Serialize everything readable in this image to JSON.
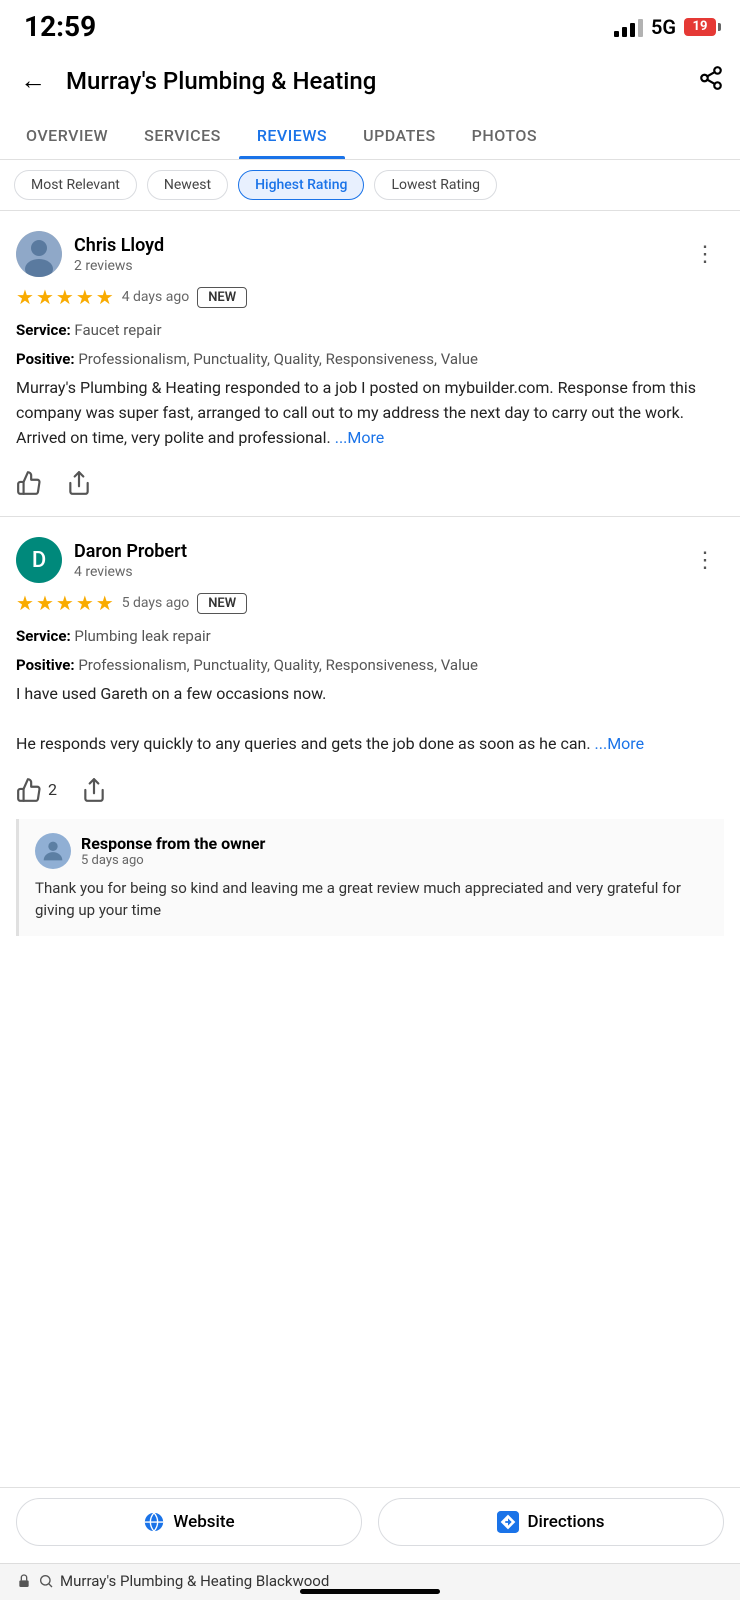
{
  "statusBar": {
    "time": "12:59",
    "network": "5G",
    "battery": "19"
  },
  "header": {
    "title": "Murray's Plumbing & Heating",
    "back_label": "←",
    "share_label": "share"
  },
  "tabs": [
    {
      "id": "overview",
      "label": "OVERVIEW",
      "active": false
    },
    {
      "id": "services",
      "label": "SERVICES",
      "active": false
    },
    {
      "id": "reviews",
      "label": "REVIEWS",
      "active": true
    },
    {
      "id": "updates",
      "label": "UPDATES",
      "active": false
    },
    {
      "id": "photos",
      "label": "PHOTOS",
      "active": false
    }
  ],
  "filters": [
    {
      "id": "most-relevant",
      "label": "Most Relevant",
      "active": false
    },
    {
      "id": "newest",
      "label": "Newest",
      "active": false
    },
    {
      "id": "highest-rating",
      "label": "Highest Rating",
      "active": true
    },
    {
      "id": "lowest-rating",
      "label": "Lowest Rating",
      "active": false
    }
  ],
  "reviews": [
    {
      "id": "review-1",
      "reviewer": {
        "name": "Chris Lloyd",
        "count": "2 reviews",
        "avatar_type": "photo",
        "avatar_letter": "C",
        "avatar_color": "#6d8fb8"
      },
      "stars": 5,
      "time": "4 days ago",
      "is_new": true,
      "new_badge": "NEW",
      "service_label": "Service:",
      "service_value": "Faucet repair",
      "positive_label": "Positive:",
      "positive_value": "Professionalism, Punctuality, Quality, Responsiveness, Value",
      "text": "Murray's Plumbing & Heating responded to a job I posted on mybuilder.com. Response from this company was super fast, arranged to call out to my address the next day to carry out the work. Arrived on time, very polite and professional.",
      "more_label": "...More",
      "likes": 0,
      "owner_response": null
    },
    {
      "id": "review-2",
      "reviewer": {
        "name": "Daron Probert",
        "count": "4 reviews",
        "avatar_type": "letter",
        "avatar_letter": "D",
        "avatar_color": "#00897b"
      },
      "stars": 5,
      "time": "5 days ago",
      "is_new": true,
      "new_badge": "NEW",
      "service_label": "Service:",
      "service_value": "Plumbing leak repair",
      "positive_label": "Positive:",
      "positive_value": "Professionalism, Punctuality, Quality, Responsiveness, Value",
      "text": "I have used Gareth on a few occasions now.\n\nHe responds very quickly to any queries and gets the job done as soon as he can.",
      "more_label": "...More",
      "likes": 2,
      "owner_response": {
        "name": "Response from the owner",
        "time": "5 days ago",
        "text": "Thank you for being so kind and leaving me a great review much appreciated and very grateful for giving up your time"
      }
    }
  ],
  "bottomButtons": {
    "website_label": "Website",
    "directions_label": "Directions"
  },
  "searchBar": {
    "icon": "lock",
    "text": "Murray's Plumbing & Heating Blackwood"
  }
}
